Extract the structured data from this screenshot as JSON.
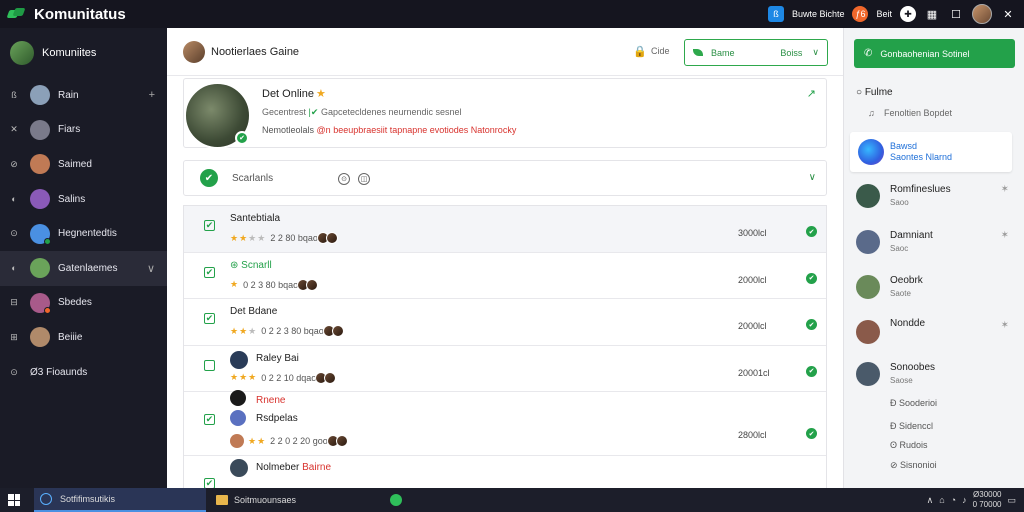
{
  "window": {
    "title": "Komunitatus"
  },
  "titlebar": {
    "badge1": "ß",
    "label1": "Buwte Bichte",
    "badge2": "ƒ6",
    "label2": "Beit"
  },
  "sidebar": {
    "header": "Komuniites",
    "items": [
      {
        "icon": "ß",
        "label": "Rain",
        "action": "+",
        "color": "#8ba0b8",
        "status": ""
      },
      {
        "icon": "✕",
        "label": "Fiars",
        "action": "",
        "color": "#7a7a8a",
        "status": ""
      },
      {
        "icon": "⊘",
        "label": "Saimed",
        "action": "",
        "color": "#c07a55",
        "status": ""
      },
      {
        "icon": "◐",
        "label": "Salins",
        "action": "",
        "color": "#8a5ab8",
        "status": ""
      },
      {
        "icon": "⊙",
        "label": "Hegnentedtis",
        "action": "",
        "color": "#4a90e2",
        "status": "#23a14a"
      },
      {
        "icon": "◐",
        "label": "Gatenlaemes",
        "action": "∨",
        "color": "#6aa35a",
        "status": ""
      },
      {
        "icon": "⊟",
        "label": "Sbedes",
        "action": "",
        "color": "#a85a8a",
        "status": "#f0672b"
      },
      {
        "icon": "⊞",
        "label": "Beiiie",
        "action": "",
        "color": "#b08a6a",
        "status": ""
      },
      {
        "icon": "⊙",
        "label": "Ø3 Fioaunds",
        "action": "",
        "color": "",
        "status": ""
      }
    ]
  },
  "main": {
    "header_title": "Nootierlaes Gaine",
    "lock_label": "Cide",
    "game_select": {
      "label": "Bame",
      "value": "Boiss"
    },
    "profile": {
      "name": "Det Online",
      "desc_pre": "Gecentrest",
      "desc_post": "Gapcetecldenes neurnendic sesnel",
      "tags_pre": "Nemotleolals",
      "tags_red": "@n beeupbraesiit tapnapne evotiodes Natonrocky"
    },
    "status_label": "Scarlanls",
    "rows": [
      {
        "name": "Santebtiala",
        "name_color": "normal",
        "stars": 2,
        "rating": "2 2 80 bqaol",
        "amount": "3000lcl",
        "selected": true,
        "checked": true,
        "icon": "",
        "name2": ""
      },
      {
        "name": "Scnarll",
        "name_color": "green",
        "stars": 1,
        "rating": "0 2 3 80 bqaol",
        "amount": "2000lcl",
        "selected": false,
        "checked": true,
        "icon": "",
        "name2": ""
      },
      {
        "name": "Det Bdane",
        "name_color": "normal",
        "stars": 2,
        "rating": "0 2 2 3 80 bqaol",
        "amount": "2000lcl",
        "selected": false,
        "checked": true,
        "icon": "",
        "name2": ""
      },
      {
        "name": "Raley Bai",
        "name_color": "normal",
        "stars": 2,
        "rating": "0 2 2 10 dqaol",
        "amount": "20001cl",
        "selected": false,
        "checked": false,
        "icon": "#2a3c58",
        "name2": ""
      },
      {
        "name": "Rnene",
        "name_color": "red",
        "stars": 2,
        "rating": "2 2 0 2 20 gool",
        "amount": "2800lcl",
        "selected": false,
        "checked": true,
        "icon": "#1a1a1a",
        "name2": "Rsdpelas"
      },
      {
        "name": "Nolmeber",
        "name_color": "normal",
        "stars": 0,
        "rating": "",
        "amount": "",
        "selected": false,
        "checked": true,
        "icon": "#3a4a5a",
        "name2": "Bairne"
      }
    ]
  },
  "right": {
    "call_label": "Gonbaohenian Sotinel",
    "section": "Fulme",
    "sub": "Fenoltien Bopdet",
    "card": {
      "t1": "Bawsd",
      "t2": "Saontes Nlarnd"
    },
    "contacts": [
      {
        "name": "Romfineslues",
        "sub": "Saoo",
        "pin": "✶",
        "color": "#3a5a4a"
      },
      {
        "name": "Damniant",
        "sub": "Saoc",
        "pin": "✶",
        "color": "#5a6a8a"
      },
      {
        "name": "Oeobrk",
        "sub": "Saote",
        "pin": "",
        "color": "#6a8a5a"
      },
      {
        "name": "Nondde",
        "sub": "",
        "pin": "✶",
        "color": "#8a5a4a"
      },
      {
        "name": "Sonoobes",
        "sub": "Saose",
        "pin": "",
        "color": "#4a5a6a"
      }
    ],
    "links": [
      "Sooderioi",
      "Sidenccl",
      "Rudois",
      "Sisnonioi"
    ]
  },
  "taskbar": {
    "item1": "Sotfifimsutikis",
    "item2": "Soitmuounsaes",
    "clock1": "Ø30000",
    "clock2": "0 70000"
  }
}
